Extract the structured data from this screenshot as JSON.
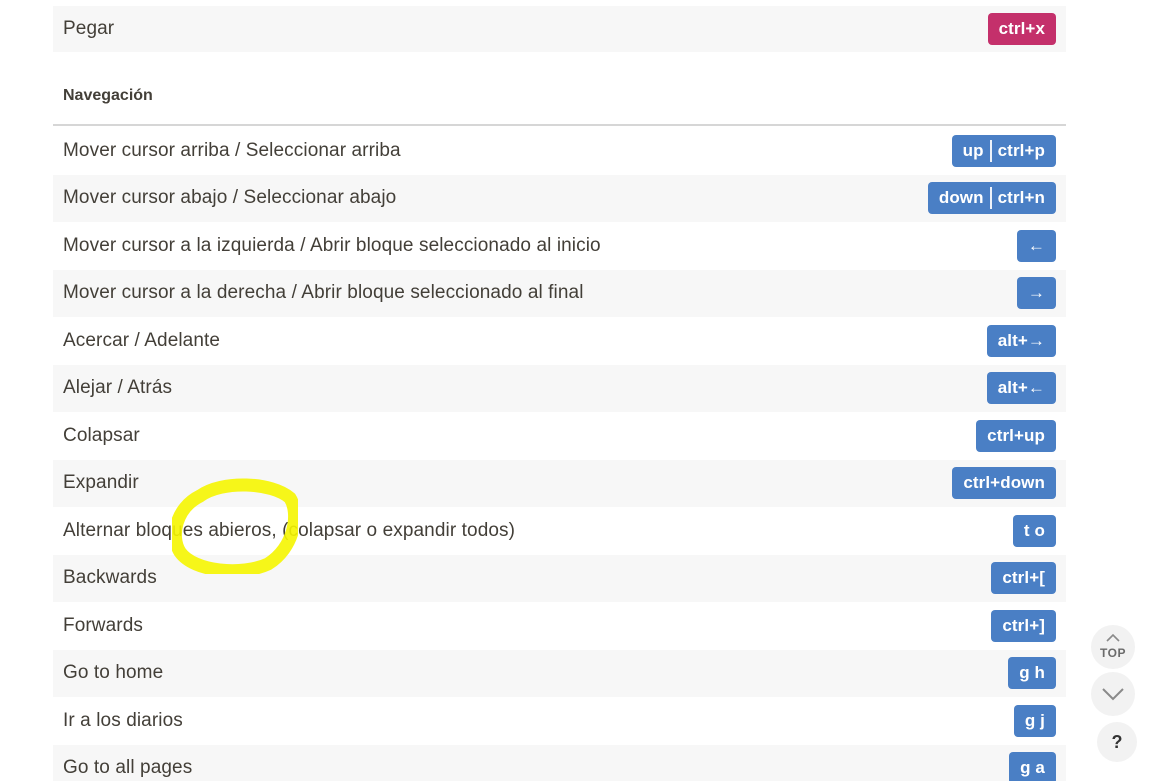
{
  "top_row": {
    "label": "Pegar",
    "keys": [
      "ctrl+x"
    ],
    "key_color": "#c4306b"
  },
  "section": {
    "title": "Navegación"
  },
  "rows": [
    {
      "label": "Mover cursor arriba / Seleccionar arriba",
      "keys": [
        "up",
        "ctrl+p"
      ]
    },
    {
      "label": "Mover cursor abajo / Seleccionar abajo",
      "keys": [
        "down",
        "ctrl+n"
      ]
    },
    {
      "label": "Mover cursor a la izquierda / Abrir bloque seleccionado al inicio",
      "keys": [
        "←"
      ]
    },
    {
      "label": "Mover cursor a la derecha / Abrir bloque seleccionado al final",
      "keys": [
        "→"
      ]
    },
    {
      "label": "Acercar / Adelante",
      "keys": [
        "alt+→"
      ]
    },
    {
      "label": "Alejar / Atrás",
      "keys": [
        "alt+←"
      ]
    },
    {
      "label": "Colapsar",
      "keys": [
        "ctrl+up"
      ]
    },
    {
      "label": "Expandir",
      "keys": [
        "ctrl+down"
      ]
    },
    {
      "label": "Alternar bloques abieros, (colapsar o expandir todos)",
      "keys": [
        "t o"
      ]
    },
    {
      "label": "Backwards",
      "keys": [
        "ctrl+["
      ]
    },
    {
      "label": "Forwards",
      "keys": [
        "ctrl+]"
      ]
    },
    {
      "label": "Go to home",
      "keys": [
        "g h"
      ]
    },
    {
      "label": "Ir a los diarios",
      "keys": [
        "g j"
      ]
    },
    {
      "label": "Go to all pages",
      "keys": [
        "g a"
      ]
    }
  ],
  "key_color": "#4a7fc5",
  "highlight_color": "#f5f500",
  "floating": {
    "top_label": "TOP",
    "top_icon": "chevron-up-icon",
    "down_icon": "chevron-down-icon",
    "help_label": "?"
  }
}
